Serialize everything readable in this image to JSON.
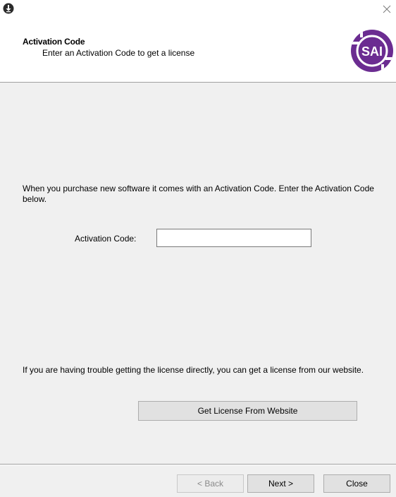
{
  "window": {
    "app_icon": "download-circle-icon",
    "close_icon": "close-icon"
  },
  "header": {
    "title": "Activation Code",
    "subtitle": "Enter an Activation Code to get a license",
    "logo_text": "SAI",
    "logo_color": "#6b2c91"
  },
  "main": {
    "intro_text": "When you purchase new software it comes with an Activation Code.  Enter the Activation Code below.",
    "code_label": "Activation Code:",
    "code_value": "",
    "trouble_text": "If you are having trouble getting the license directly, you can get a license from our website.",
    "website_button": "Get License From Website"
  },
  "footer": {
    "back_label": "< Back",
    "next_label": "Next >",
    "close_label": "Close"
  }
}
